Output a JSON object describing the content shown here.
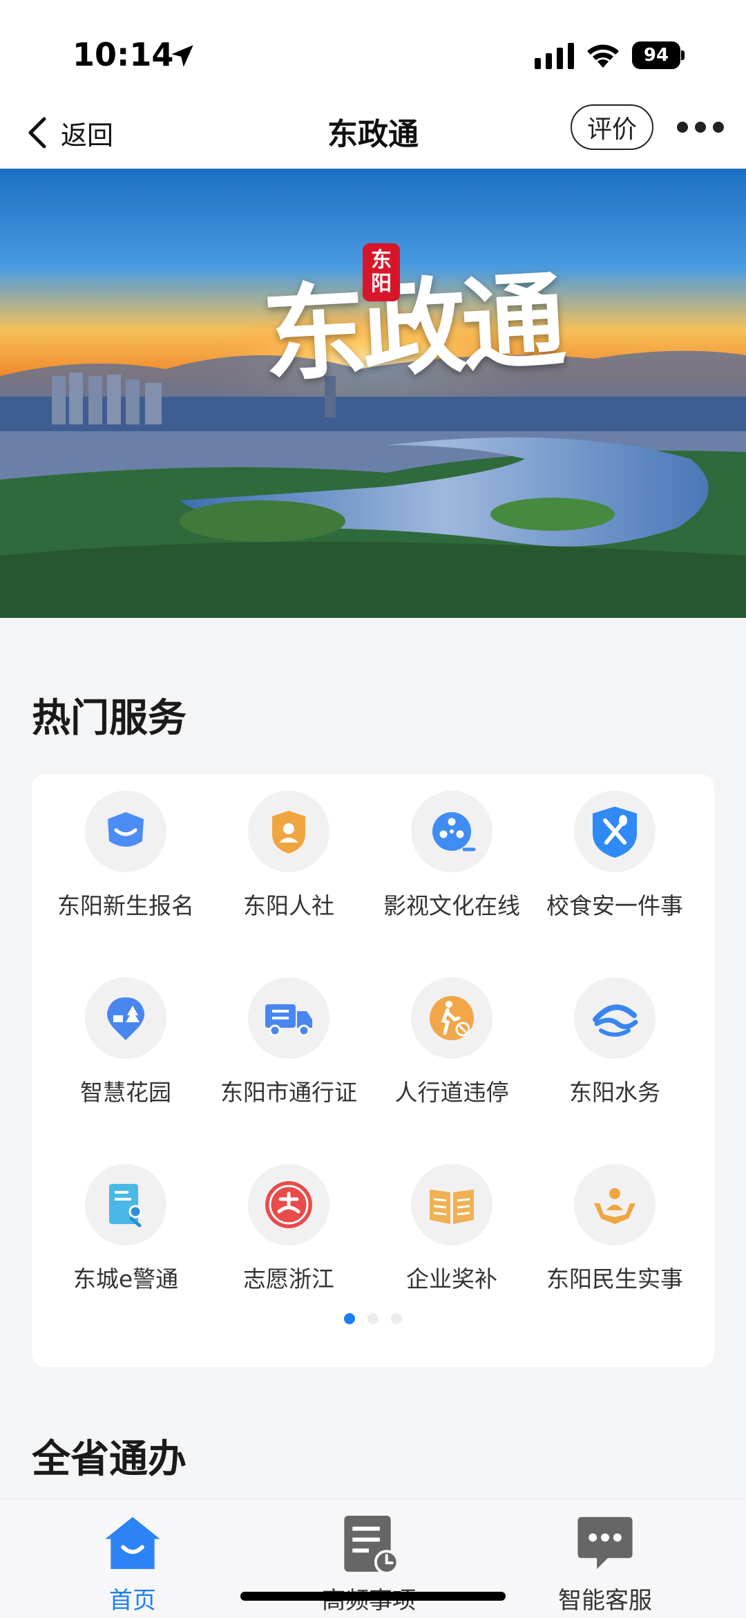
{
  "status_bar": {
    "time": "10:14",
    "battery": "94"
  },
  "nav": {
    "back_label": "返回",
    "title": "东政通",
    "rate_label": "评价"
  },
  "banner": {
    "title": "东政通",
    "seal_line1": "东",
    "seal_line2": "阳"
  },
  "hot_services": {
    "title": "热门服务",
    "items": [
      {
        "label": "东阳新生报名",
        "icon": "graduation-cap-icon"
      },
      {
        "label": "东阳人社",
        "icon": "person-badge-icon"
      },
      {
        "label": "影视文化在线",
        "icon": "film-reel-icon"
      },
      {
        "label": "校食安一件事",
        "icon": "fork-spoon-shield-icon"
      },
      {
        "label": "智慧花园",
        "icon": "garden-pin-icon"
      },
      {
        "label": "东阳市通行证",
        "icon": "truck-pass-icon"
      },
      {
        "label": "人行道违停",
        "icon": "pedestrian-no-parking-icon"
      },
      {
        "label": "东阳水务",
        "icon": "water-wave-icon"
      },
      {
        "label": "东城e警通",
        "icon": "police-form-icon"
      },
      {
        "label": "志愿浙江",
        "icon": "volunteer-badge-icon"
      },
      {
        "label": "企业奖补",
        "icon": "open-book-icon"
      },
      {
        "label": "东阳民生实事",
        "icon": "hands-person-icon"
      }
    ],
    "page_index": 1,
    "page_count": 3
  },
  "province": {
    "title": "全省通办"
  },
  "tab_bar": {
    "tabs": [
      {
        "label": "首页",
        "icon": "home-icon",
        "active": true
      },
      {
        "label": "高频事项",
        "icon": "document-clock-icon",
        "active": false
      },
      {
        "label": "智能客服",
        "icon": "chat-bubble-icon",
        "active": false
      }
    ]
  },
  "colors": {
    "accent": "#1a7ff5",
    "icon_bg": "#f1f1f2",
    "page_bg": "#f4f5f7"
  }
}
